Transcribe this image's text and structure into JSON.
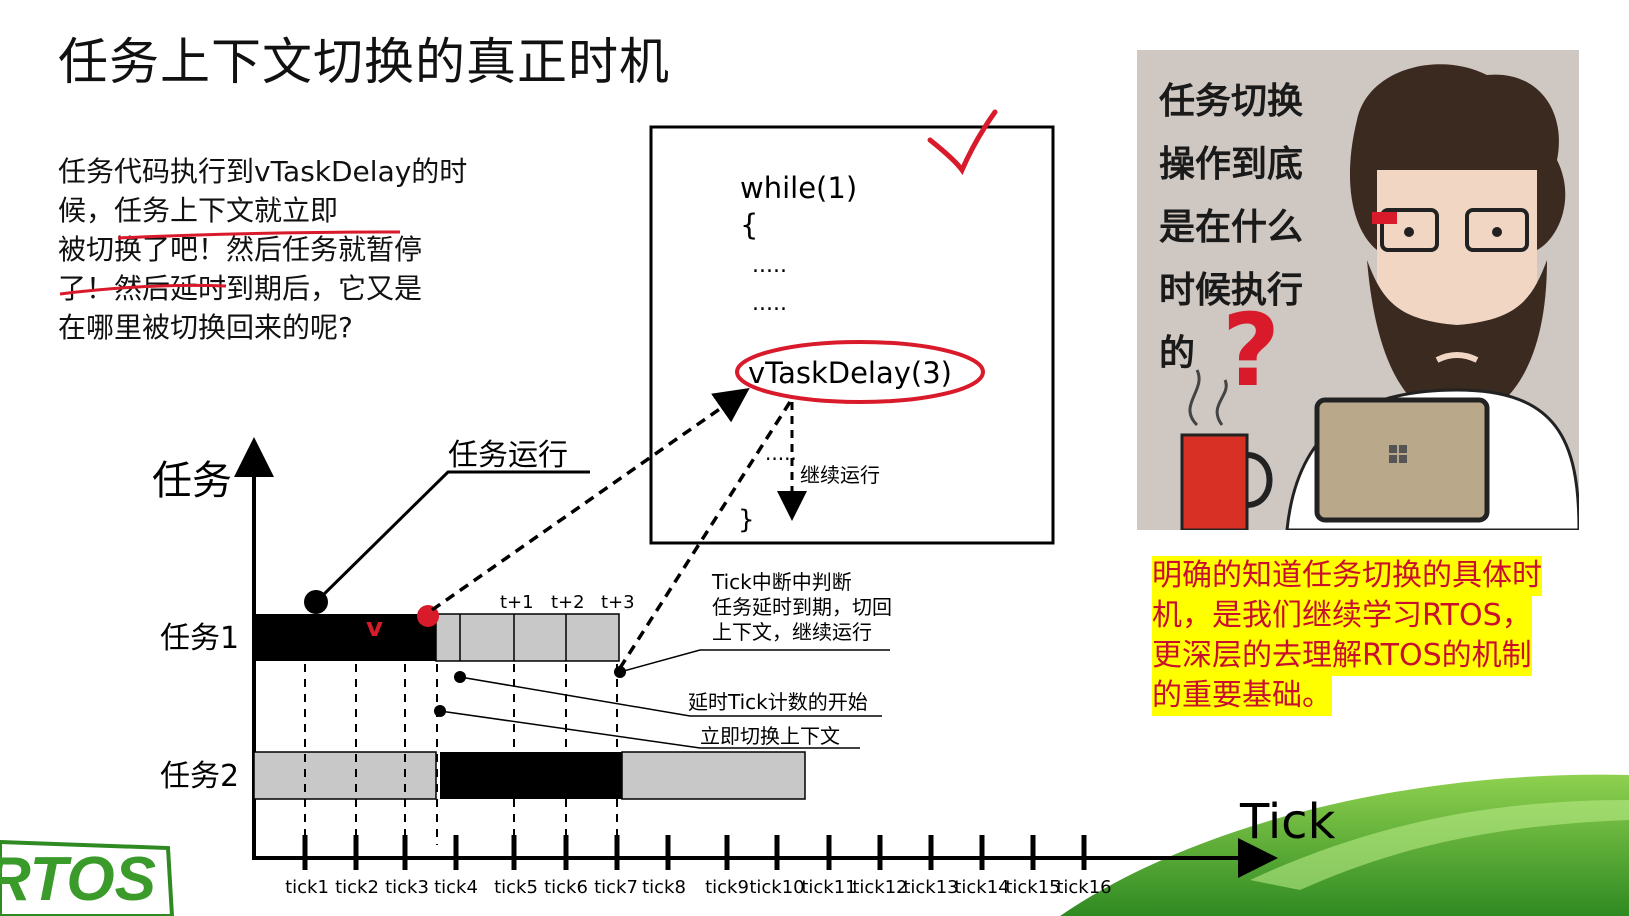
{
  "title": "任务上下文切换的真正时机",
  "question_lines": [
    "任务代码执行到vTaskDelay的时",
    "候，任务上下文就立即",
    "被切换了吧！然后任务就暂停",
    "了！然后延时到期后，它又是",
    "在哪里被切换回来的呢?"
  ],
  "code_box": {
    "lines": [
      "while(1)",
      "{",
      ".....",
      ".....",
      "vTaskDelay(3)",
      ".....",
      "}"
    ],
    "continue_label": "继续运行"
  },
  "diagram": {
    "y_axis_label": "任务",
    "x_axis_label": "Tick",
    "task_run_label": "任务运行",
    "task1_label": "任务1",
    "task2_label": "任务2",
    "tick_labels": [
      "tick1",
      "tick2",
      "tick3",
      "tick4",
      "tick5",
      "tick6",
      "tick7",
      "tick8",
      "tick9",
      "tick10",
      "tick11",
      "tick12",
      "tick13",
      "tick14",
      "tick15",
      "tick16"
    ],
    "t_labels": [
      "t+1",
      "t+2",
      "t+3"
    ],
    "tick_interrupt_note": [
      "Tick中断中判断",
      "任务延时到期，切回",
      "上下文，继续运行"
    ],
    "delay_start_label": "延时Tick计数的开始",
    "switch_context_label": "立即切换上下文",
    "red_mark": "v"
  },
  "photo_question_lines": [
    "任务切换",
    "操作到底",
    "是在什么",
    "时候执行",
    "的"
  ],
  "photo_question_mark": "?",
  "right_note_lines": [
    "明确的知道任务切换的具体时",
    "机，是我们继续学习RTOS，",
    "更深层的去理解RTOS的机制",
    "的重要基础。"
  ],
  "logo_text": "RTOS",
  "colors": {
    "accent_red": "#d91a2a",
    "highlight_yellow": "#ffff00",
    "logo_green": "#3a9a2a",
    "bar_black": "#000000",
    "bar_gray": "#c8c8c8"
  }
}
